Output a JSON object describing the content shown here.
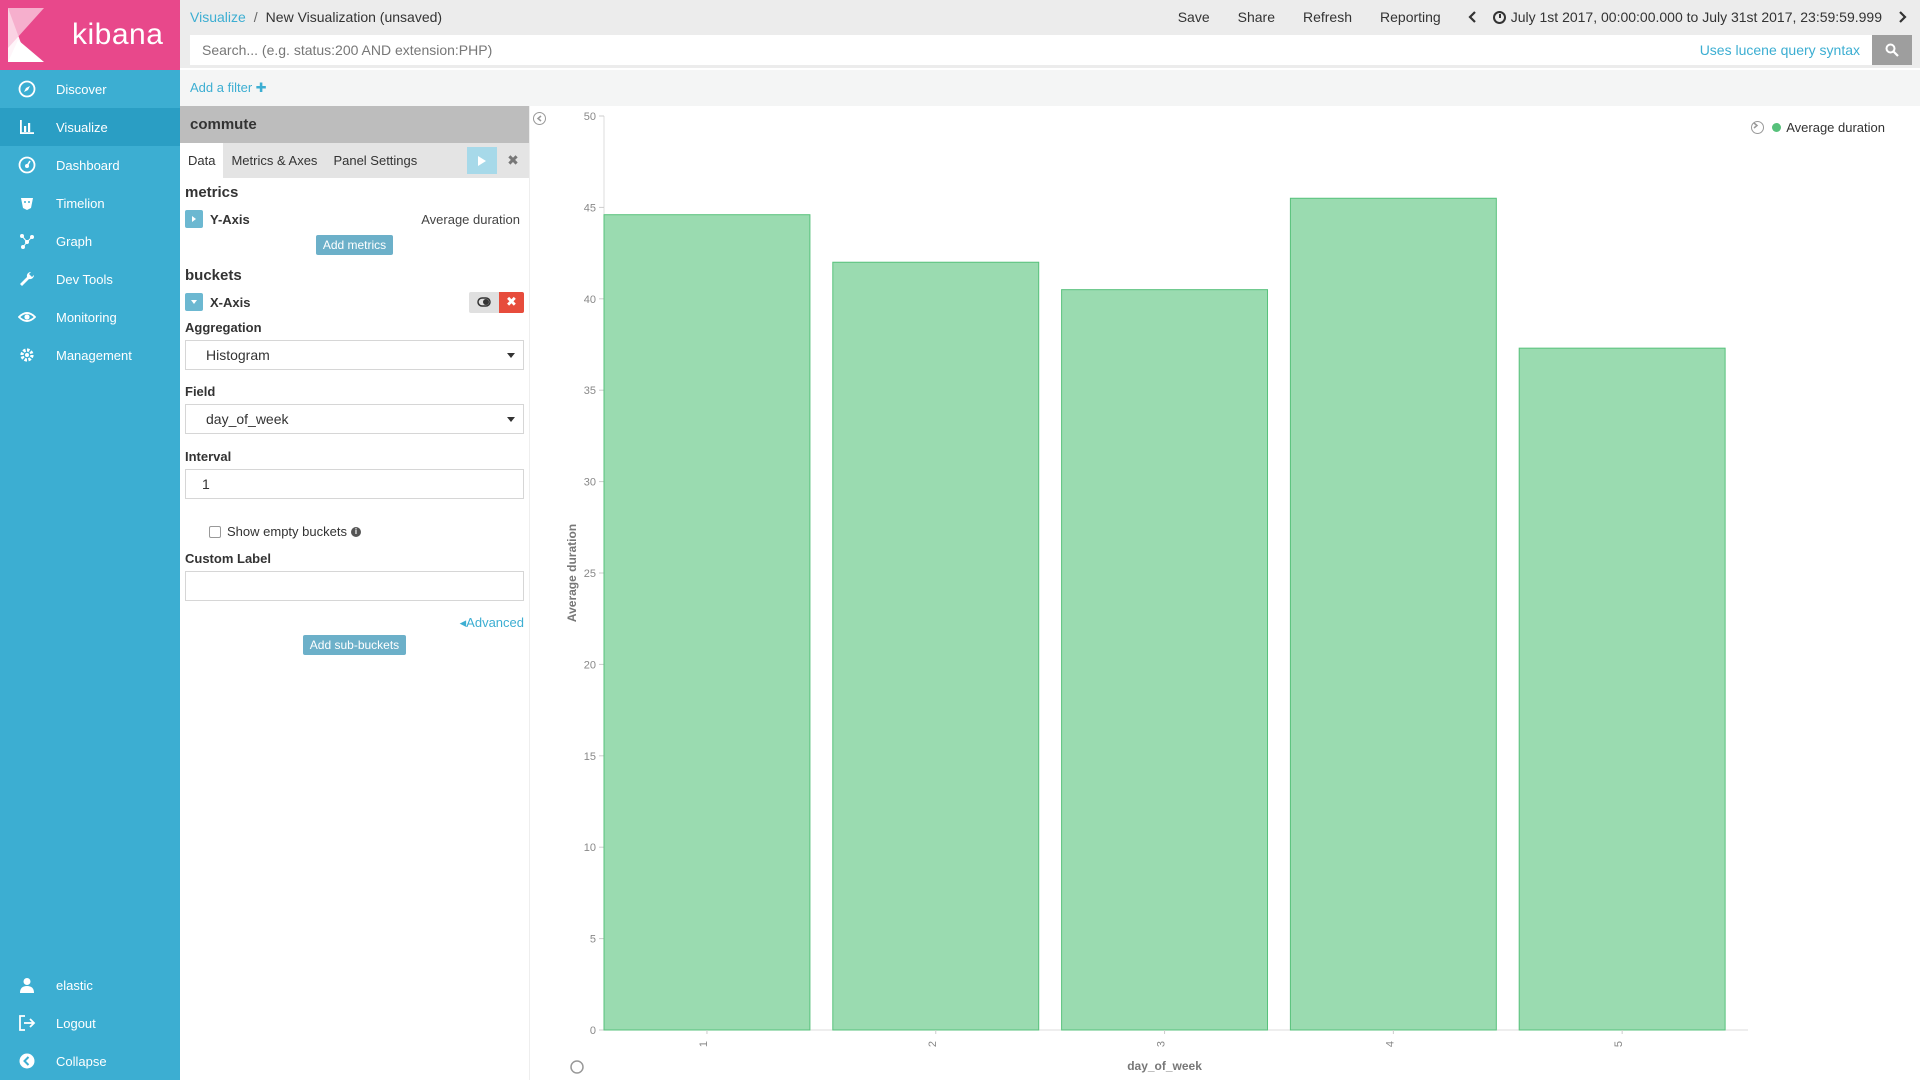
{
  "brand": {
    "name": "kibana"
  },
  "nav": {
    "items": [
      {
        "label": "Discover",
        "icon": "compass-icon"
      },
      {
        "label": "Visualize",
        "icon": "bar-chart-icon"
      },
      {
        "label": "Dashboard",
        "icon": "dashboard-icon"
      },
      {
        "label": "Timelion",
        "icon": "timelion-icon"
      },
      {
        "label": "Graph",
        "icon": "graph-icon"
      },
      {
        "label": "Dev Tools",
        "icon": "wrench-icon"
      },
      {
        "label": "Monitoring",
        "icon": "eye-icon"
      },
      {
        "label": "Management",
        "icon": "gear-icon"
      }
    ],
    "bottom": [
      {
        "label": "elastic",
        "icon": "user-icon"
      },
      {
        "label": "Logout",
        "icon": "logout-icon"
      },
      {
        "label": "Collapse",
        "icon": "collapse-icon"
      }
    ],
    "active_index": 1
  },
  "header": {
    "breadcrumb_link": "Visualize",
    "breadcrumb_sep": "/",
    "breadcrumb_current": "New Visualization (unsaved)",
    "actions": [
      "Save",
      "Share",
      "Refresh",
      "Reporting"
    ],
    "time_range": "July 1st 2017, 00:00:00.000 to July 31st 2017, 23:59:59.999"
  },
  "search": {
    "placeholder": "Search... (e.g. status:200 AND extension:PHP)",
    "syntax_link": "Uses lucene query syntax"
  },
  "filter": {
    "add_label": "Add a filter ✚"
  },
  "editor": {
    "index_title": "commute",
    "tabs": [
      "Data",
      "Metrics & Axes",
      "Panel Settings"
    ],
    "metrics_title": "metrics",
    "metric_agg_label": "Y-Axis",
    "metric_agg_desc": "Average duration",
    "add_metrics": "Add metrics",
    "buckets_title": "buckets",
    "bucket_agg_label": "X-Axis",
    "aggregation_label": "Aggregation",
    "aggregation_value": "Histogram",
    "field_label": "Field",
    "field_value": "day_of_week",
    "interval_label": "Interval",
    "interval_value": "1",
    "show_empty_label": "Show empty buckets",
    "custom_label_label": "Custom Label",
    "custom_label_value": "",
    "advanced_link": "Advanced",
    "add_sub_buckets": "Add sub-buckets"
  },
  "colors": {
    "sidebar": "#3caed2",
    "brand": "#e8488b",
    "bar_fill": "#9adbb0",
    "bar_stroke": "#57c17b",
    "legend_dot": "#57c17b"
  },
  "chart_data": {
    "type": "bar",
    "categories": [
      "1",
      "2",
      "3",
      "4",
      "5"
    ],
    "series": [
      {
        "name": "Average duration",
        "values": [
          44.6,
          42,
          40.5,
          45.5,
          37.3
        ]
      }
    ],
    "xlabel": "day_of_week",
    "ylabel": "Average duration",
    "ylim": [
      0,
      50
    ],
    "yticks": [
      0,
      5,
      10,
      15,
      20,
      25,
      30,
      35,
      40,
      45,
      50
    ],
    "legend_position": "top-right",
    "grid": false
  }
}
